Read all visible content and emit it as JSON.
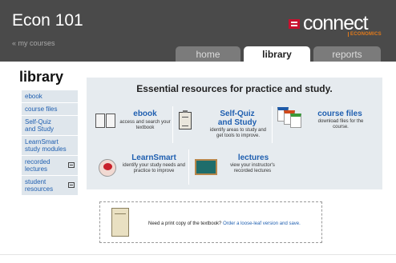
{
  "header": {
    "course_title": "Econ 101",
    "my_courses": "« my courses",
    "logo_brand": "connect",
    "logo_sub": "ECONOMICS"
  },
  "tabs": [
    {
      "label": "home",
      "active": false
    },
    {
      "label": "library",
      "active": true
    },
    {
      "label": "reports",
      "active": false
    }
  ],
  "sidebar": {
    "title": "library",
    "items": [
      {
        "label": "ebook",
        "icon": ""
      },
      {
        "label": "course files",
        "icon": ""
      },
      {
        "label": "Self-Quiz and Study",
        "icon": ""
      },
      {
        "label": "LearnSmart study modules",
        "icon": ""
      },
      {
        "label": "recorded lectures",
        "icon": "screen-icon"
      },
      {
        "label": "student resources",
        "icon": "screen-icon"
      }
    ]
  },
  "main": {
    "heading": "Essential resources for practice and study.",
    "resources": {
      "ebook": {
        "title": "ebook",
        "desc": "access and search your textbook"
      },
      "self_quiz": {
        "title": "Self-Quiz and Study",
        "desc": "identify areas to study and get tools to improve."
      },
      "course_files": {
        "title": "course files",
        "desc": "download files for the course."
      },
      "learnsmart": {
        "title": "LearnSmart",
        "desc": "identify your study needs and practice to improve"
      },
      "lectures": {
        "title": "lectures",
        "desc": "view your instructor's recorded lectures"
      }
    }
  },
  "print": {
    "question": "Need a print copy of the textbook?",
    "link_text": "Order a loose-leaf version and save."
  },
  "colors": {
    "header_bg": "#4a4a4a",
    "link": "#1f5fb0",
    "accent": "#c8102e",
    "sidebar_bg": "#dfe6ec",
    "panel_bg": "#e6ebef"
  }
}
